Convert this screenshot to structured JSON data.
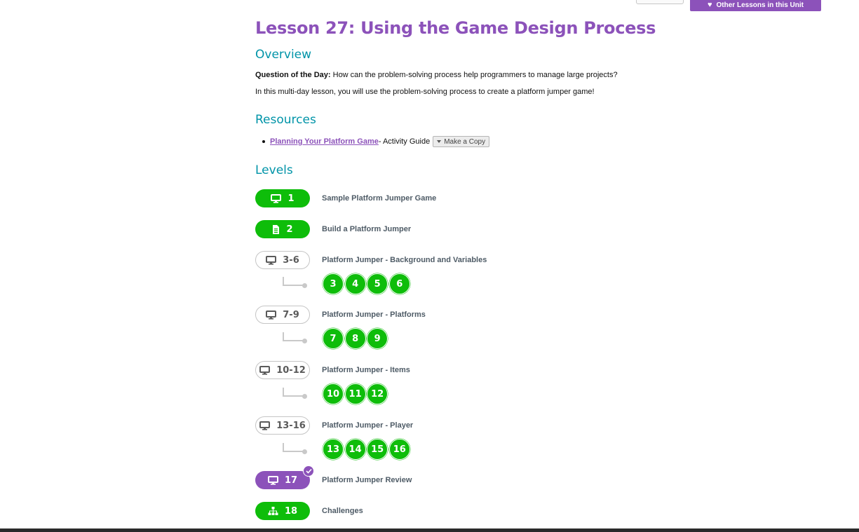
{
  "header": {
    "other_lessons_label": "Other Lessons in this Unit"
  },
  "lesson": {
    "title": "Lesson 27: Using the Game Design Process"
  },
  "overview": {
    "heading": "Overview",
    "qotd_label": "Question of the Day:",
    "qotd_text": " How can the problem-solving process help programmers to manage large projects?",
    "description": "In this multi-day lesson, you will use the problem-solving process to create a platform jumper game!"
  },
  "resources": {
    "heading": "Resources",
    "items": [
      {
        "link_text": "Planning Your Platform Game",
        "suffix": " - Activity Guide",
        "copy_label": "Make a Copy"
      }
    ]
  },
  "levels": {
    "heading": "Levels",
    "items": [
      {
        "pill": "1",
        "label": "Sample Platform Jumper Game",
        "icon": "monitor-icon",
        "style": "green"
      },
      {
        "pill": "2",
        "label": "Build a Platform Jumper",
        "icon": "document-icon",
        "style": "green"
      },
      {
        "pill": "3-6",
        "label": "Platform Jumper - Background and Variables",
        "icon": "monitor-icon",
        "style": "outline",
        "bubbles": [
          "3",
          "4",
          "5",
          "6"
        ]
      },
      {
        "pill": "7-9",
        "label": "Platform Jumper - Platforms",
        "icon": "monitor-icon",
        "style": "outline",
        "bubbles": [
          "7",
          "8",
          "9"
        ]
      },
      {
        "pill": "10-12",
        "label": "Platform Jumper - Items",
        "icon": "monitor-icon",
        "style": "outline",
        "bubbles": [
          "10",
          "11",
          "12"
        ]
      },
      {
        "pill": "13-16",
        "label": "Platform Jumper - Player",
        "icon": "monitor-icon",
        "style": "outline",
        "bubbles": [
          "13",
          "14",
          "15",
          "16"
        ]
      },
      {
        "pill": "17",
        "label": "Platform Jumper Review",
        "icon": "monitor-icon",
        "style": "purple",
        "completed": true
      },
      {
        "pill": "18",
        "label": "Challenges",
        "icon": "hierarchy-icon",
        "style": "green"
      }
    ]
  },
  "colors": {
    "purple": "#8c52ba",
    "teal": "#0094a8",
    "green": "#0ebd0a"
  }
}
